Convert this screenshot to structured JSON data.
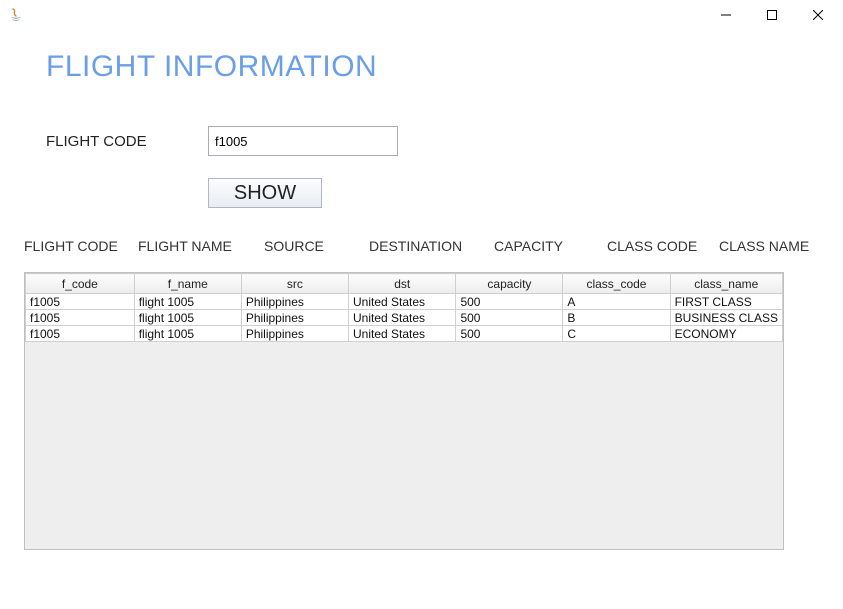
{
  "window": {
    "minimize": "—",
    "maximize": "☐",
    "close": "✕"
  },
  "page": {
    "title": "FLIGHT INFORMATION"
  },
  "form": {
    "flight_code_label": "FLIGHT CODE",
    "flight_code_value": "f1005",
    "show_button": "SHOW"
  },
  "column_headings": {
    "c1": "FLIGHT CODE",
    "c2": "FLIGHT NAME",
    "c3": "SOURCE",
    "c4": "DESTINATION",
    "c5": "CAPACITY",
    "c6": "CLASS CODE",
    "c7": "CLASS NAME"
  },
  "table": {
    "headers": {
      "h1": "f_code",
      "h2": "f_name",
      "h3": "src",
      "h4": "dst",
      "h5": "capacity",
      "h6": "class_code",
      "h7": "class_name"
    },
    "rows": [
      {
        "c1": "f1005",
        "c2": "flight 1005",
        "c3": "Philippines",
        "c4": "United States",
        "c5": "500",
        "c6": "A",
        "c7": "FIRST CLASS"
      },
      {
        "c1": "f1005",
        "c2": "flight 1005",
        "c3": "Philippines",
        "c4": "United States",
        "c5": "500",
        "c6": "B",
        "c7": "BUSINESS CLASS"
      },
      {
        "c1": "f1005",
        "c2": "flight 1005",
        "c3": "Philippines",
        "c4": "United States",
        "c5": "500",
        "c6": "C",
        "c7": "ECONOMY"
      }
    ]
  }
}
